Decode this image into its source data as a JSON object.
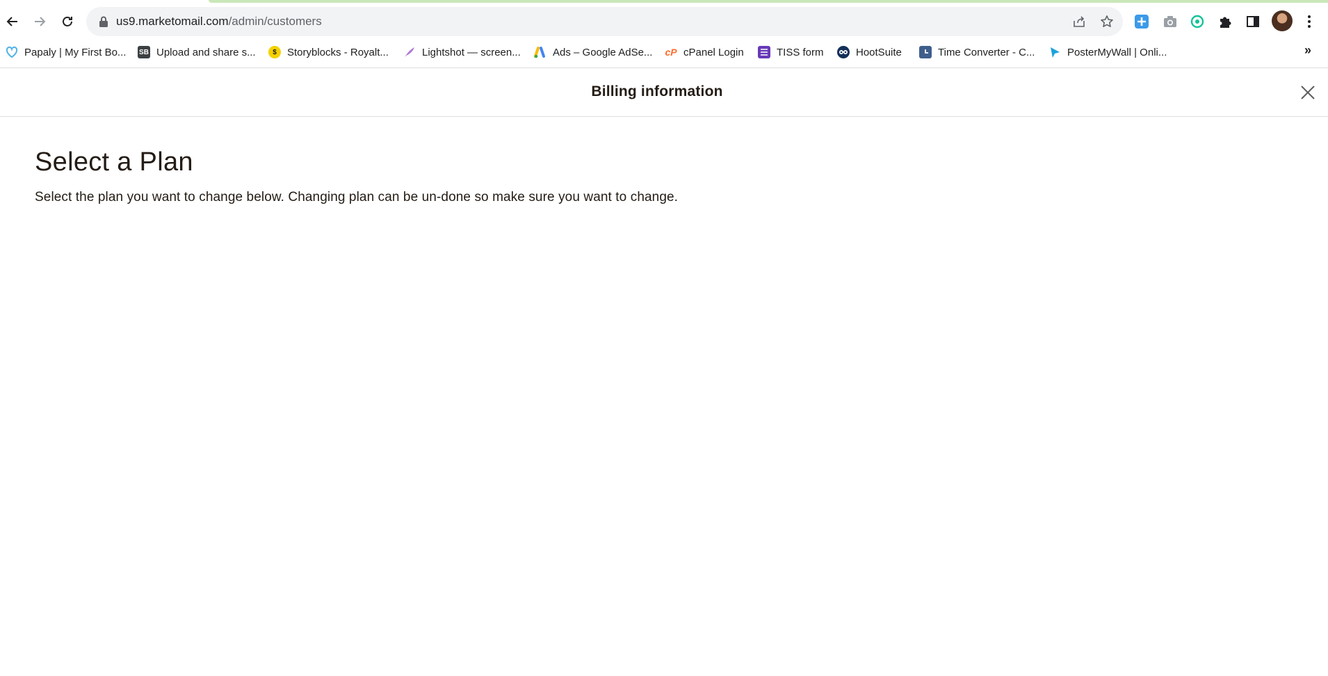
{
  "browser": {
    "url_host": "us9.marketomail.com",
    "url_path": "/admin/customers",
    "bookmarks": [
      {
        "label": "Papaly | My First Bo...",
        "icon": "heart-icon",
        "color": "#4fb3e8"
      },
      {
        "label": "Upload and share s...",
        "icon": "sb-icon",
        "color": "#3c4043"
      },
      {
        "label": "Storyblocks - Royalt...",
        "icon": "storyblocks-icon",
        "color": "#f5d100"
      },
      {
        "label": "Lightshot — screen...",
        "icon": "feather-icon",
        "color": "#8e44ad"
      },
      {
        "label": "Ads – Google AdSe...",
        "icon": "google-ads-icon",
        "color": "#fbbc04"
      },
      {
        "label": "cPanel Login",
        "icon": "cpanel-icon",
        "color": "#ff6c2c"
      },
      {
        "label": "TISS form",
        "icon": "form-icon",
        "color": "#673ab7"
      },
      {
        "label": "HootSuite",
        "icon": "owl-icon",
        "color": "#143059"
      },
      {
        "label": "Time Converter - C...",
        "icon": "clock-icon",
        "color": "#3f5e8c"
      },
      {
        "label": "PosterMyWall | Onli...",
        "icon": "postermywall-icon",
        "color": "#1aa3d9"
      }
    ],
    "more_bookmarks": "»"
  },
  "header": {
    "title": "Billing information"
  },
  "main": {
    "heading": "Select a Plan",
    "description": "Select the plan you want to change below. Changing plan can be un-done so make sure you want to change."
  }
}
